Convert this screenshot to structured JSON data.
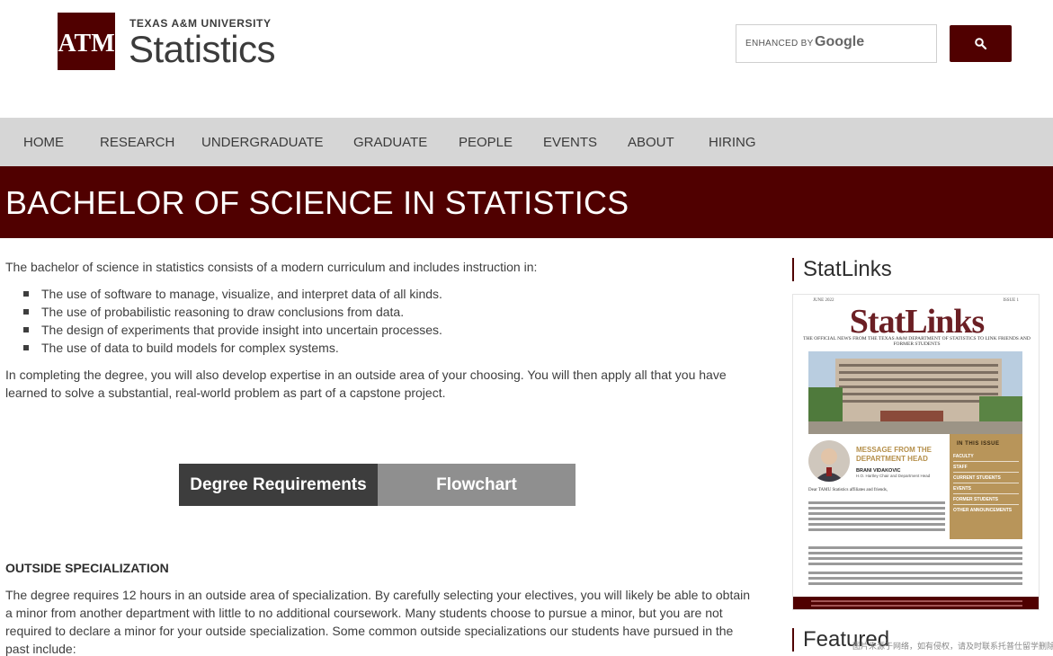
{
  "header": {
    "logo_text": "ATM",
    "university": "TEXAS A&M UNIVERSITY",
    "site_title": "Statistics"
  },
  "search": {
    "enhanced_label": "ENHANCED BY",
    "provider": "Google",
    "button_icon": "search-icon"
  },
  "nav": {
    "items": [
      {
        "label": "HOME"
      },
      {
        "label": "RESEARCH"
      },
      {
        "label": "UNDERGRADUATE"
      },
      {
        "label": "GRADUATE"
      },
      {
        "label": "PEOPLE"
      },
      {
        "label": "EVENTS"
      },
      {
        "label": "ABOUT"
      },
      {
        "label": "HIRING"
      }
    ]
  },
  "page": {
    "title": "BACHELOR OF SCIENCE IN STATISTICS",
    "intro": "The bachelor of science in statistics consists of a modern curriculum and includes instruction in:",
    "bullets": [
      "The use of software to manage, visualize, and interpret data of all kinds.",
      "The use of probabilistic reasoning to draw conclusions from data.",
      "The design of experiments that provide insight into uncertain processes.",
      "The use of data to build models for complex systems."
    ],
    "paragraph2": "In completing the degree, you will also develop expertise in an outside area of your choosing. You will then apply all that you have learned to solve a substantial, real-world problem as part of a capstone project.",
    "buttons": {
      "requirements": "Degree Requirements",
      "flowchart": "Flowchart"
    },
    "outside_heading": "OUTSIDE SPECIALIZATION",
    "outside_paragraph": "The degree requires 12 hours in an outside area of specialization. By carefully selecting your electives, you will likely be able to obtain a minor from another department with little to no additional coursework. Many students choose to pursue a minor, but you are not required to declare a minor for your outside specialization.  Some common outside specializations our students have pursued in the past include:"
  },
  "sidebar": {
    "statlinks_heading": "StatLinks",
    "featured_heading": "Featured",
    "newsletter": {
      "date": "JUNE 2022",
      "issue": "ISSUE 1",
      "title": "StatLinks",
      "subtitle": "THE OFFICIAL NEWS FROM THE TEXAS A&M DEPARTMENT OF STATISTICS TO LINK FRIENDS AND FORMER STUDENTS",
      "message_heading": "MESSAGE FROM THE DEPARTMENT HEAD",
      "author": "BRANI VIDAKOVIC",
      "author_role": "H.O. Hartley Chair and Department Head",
      "in_this_issue": "IN THIS ISSUE",
      "toc": [
        "FACULTY",
        "STAFF",
        "CURRENT STUDENTS",
        "EVENTS",
        "FORMER STUDENTS",
        "OTHER ANNOUNCEMENTS"
      ],
      "greeting": "Dear TAMU Statistics affiliates and friends,"
    }
  },
  "watermark": "图片来源于网络，如有侵权，请及时联系托普仕留学删除",
  "colors": {
    "maroon": "#500000",
    "nav_bg": "#d6d6d6",
    "gold": "#b8955a"
  }
}
